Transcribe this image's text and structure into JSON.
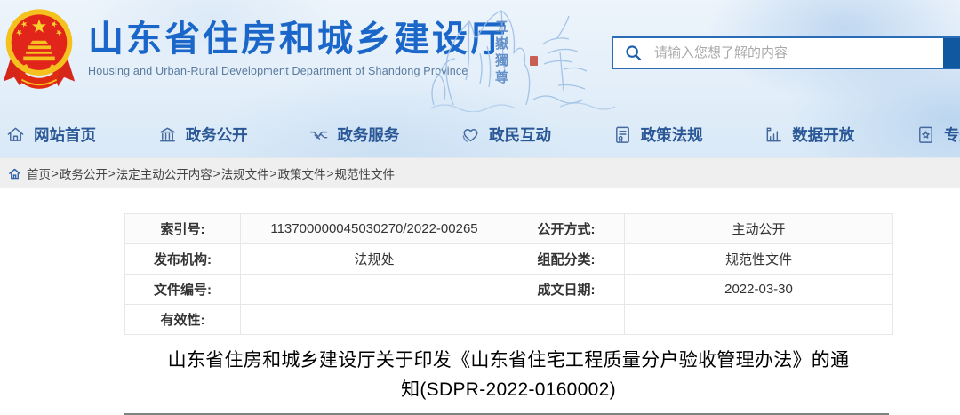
{
  "header": {
    "site_name": "山东省住房和城乡建设厅",
    "site_name_en": "Housing and Urban-Rural Development Department of Shandong Province",
    "emblem_icon": "china-national-emblem",
    "painting_seal_text": "五嶽獨尊",
    "search": {
      "icon": "search-icon",
      "placeholder": "请输入您想了解的内容"
    }
  },
  "nav": {
    "items": [
      {
        "label": "网站首页",
        "icon": "home-icon"
      },
      {
        "label": "政务公开",
        "icon": "bank-icon"
      },
      {
        "label": "政务服务",
        "icon": "handshake-icon"
      },
      {
        "label": "政民互动",
        "icon": "heart-icon"
      },
      {
        "label": "政策法规",
        "icon": "document-seal-icon"
      },
      {
        "label": "数据开放",
        "icon": "bar-chart-icon"
      },
      {
        "label": "专题专栏",
        "icon": "star-document-icon"
      }
    ]
  },
  "breadcrumb": {
    "home_icon": "home-icon",
    "separator": ">",
    "items": [
      "首页",
      "政务公开",
      "法定主动公开内容",
      "法规文件",
      "政策文件",
      "规范性文件"
    ]
  },
  "meta_table": {
    "rows": [
      {
        "l1": "索引号:",
        "v1": "113700000045030270/2022-00265",
        "l2": "公开方式:",
        "v2": "主动公开"
      },
      {
        "l1": "发布机构:",
        "v1": "法规处",
        "l2": "组配分类:",
        "v2": "规范性文件"
      },
      {
        "l1": "文件编号:",
        "v1": "",
        "l2": "成文日期:",
        "v2": "2022-03-30"
      },
      {
        "l1": "有效性:",
        "v1": "",
        "l2": "",
        "v2": ""
      }
    ]
  },
  "document": {
    "title": "山东省住房和城乡建设厅关于印发《山东省住宅工程质量分户验收管理办法》的通知(SDPR-2022-0160002)"
  },
  "colors": {
    "accent_blue": "#1a66c9",
    "nav_blue": "#2a5795",
    "search_border": "#2b6cb7",
    "search_button": "#10589f",
    "breadcrumb_bg": "#efefef",
    "table_border": "#e7e7e7",
    "divider_gray": "#828282"
  }
}
